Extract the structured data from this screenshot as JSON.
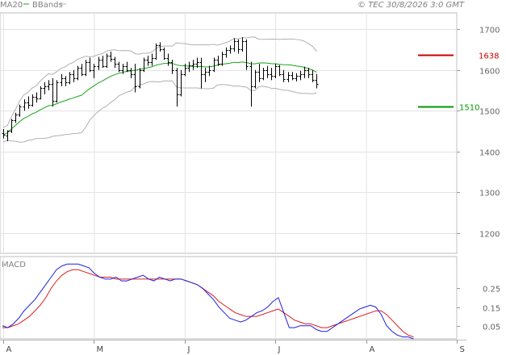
{
  "header": {
    "ma_label": "MA20",
    "bbands_label": "BBands",
    "copyright": "© TEC 30/8/2026 3:0 GMT"
  },
  "colors": {
    "ma": "#17a317",
    "bands": "#b0b0b0",
    "bars": "#000000",
    "macd_line": "#1f1fdd",
    "macd_signal": "#dd1f1f",
    "resistance": "#cc0000",
    "support": "#009900",
    "grid": "#e3e3e3"
  },
  "chart_data": [
    {
      "type": "ohlc",
      "title": "",
      "ylim": [
        1150,
        1740
      ],
      "yticks": [
        1700,
        1600,
        1500,
        1400,
        1300,
        1200
      ],
      "x_labels": [
        "A",
        "M",
        "J",
        "J",
        "A",
        "S"
      ],
      "month_tick_days": [
        0,
        22,
        44,
        66,
        88,
        110
      ],
      "n_days": 110,
      "resistance": {
        "value": 1638,
        "label": "1638"
      },
      "support": {
        "value": 1510,
        "label": "1510"
      },
      "ohlc": [
        [
          1445,
          1455,
          1432,
          1441
        ],
        [
          1440,
          1452,
          1425,
          1450
        ],
        [
          1450,
          1480,
          1445,
          1476
        ],
        [
          1476,
          1495,
          1470,
          1490
        ],
        [
          1490,
          1515,
          1485,
          1510
        ],
        [
          1510,
          1528,
          1500,
          1520
        ],
        [
          1520,
          1535,
          1505,
          1515
        ],
        [
          1515,
          1540,
          1510,
          1535
        ],
        [
          1535,
          1545,
          1520,
          1530
        ],
        [
          1530,
          1560,
          1528,
          1555
        ],
        [
          1555,
          1570,
          1540,
          1560
        ],
        [
          1560,
          1575,
          1550,
          1565
        ],
        [
          1565,
          1580,
          1510,
          1525
        ],
        [
          1525,
          1575,
          1520,
          1570
        ],
        [
          1570,
          1590,
          1560,
          1580
        ],
        [
          1580,
          1585,
          1560,
          1570
        ],
        [
          1570,
          1595,
          1565,
          1590
        ],
        [
          1590,
          1600,
          1570,
          1580
        ],
        [
          1580,
          1610,
          1575,
          1605
        ],
        [
          1605,
          1615,
          1585,
          1590
        ],
        [
          1590,
          1625,
          1585,
          1620
        ],
        [
          1620,
          1630,
          1595,
          1600
        ],
        [
          1600,
          1615,
          1580,
          1610
        ],
        [
          1610,
          1632,
          1600,
          1625
        ],
        [
          1625,
          1635,
          1605,
          1610
        ],
        [
          1610,
          1640,
          1605,
          1635
        ],
        [
          1635,
          1645,
          1620,
          1628
        ],
        [
          1628,
          1632,
          1605,
          1615
        ],
        [
          1615,
          1620,
          1595,
          1600
        ],
        [
          1600,
          1615,
          1590,
          1610
        ],
        [
          1610,
          1620,
          1595,
          1600
        ],
        [
          1600,
          1605,
          1580,
          1590
        ],
        [
          1590,
          1615,
          1545,
          1560
        ],
        [
          1560,
          1605,
          1555,
          1600
        ],
        [
          1600,
          1630,
          1595,
          1625
        ],
        [
          1625,
          1635,
          1610,
          1620
        ],
        [
          1620,
          1640,
          1610,
          1630
        ],
        [
          1630,
          1665,
          1625,
          1660
        ],
        [
          1660,
          1668,
          1645,
          1650
        ],
        [
          1650,
          1655,
          1625,
          1630
        ],
        [
          1630,
          1640,
          1610,
          1620
        ],
        [
          1620,
          1625,
          1590,
          1600
        ],
        [
          1600,
          1605,
          1510,
          1540
        ],
        [
          1540,
          1600,
          1535,
          1590
        ],
        [
          1590,
          1615,
          1585,
          1605
        ],
        [
          1605,
          1620,
          1595,
          1612
        ],
        [
          1612,
          1625,
          1600,
          1615
        ],
        [
          1615,
          1630,
          1605,
          1620
        ],
        [
          1620,
          1630,
          1555,
          1590
        ],
        [
          1590,
          1605,
          1570,
          1595
        ],
        [
          1595,
          1610,
          1585,
          1600
        ],
        [
          1600,
          1630,
          1595,
          1625
        ],
        [
          1625,
          1635,
          1610,
          1615
        ],
        [
          1615,
          1645,
          1610,
          1640
        ],
        [
          1640,
          1655,
          1630,
          1648
        ],
        [
          1648,
          1660,
          1640,
          1652
        ],
        [
          1652,
          1678,
          1645,
          1670
        ],
        [
          1670,
          1675,
          1640,
          1650
        ],
        [
          1650,
          1680,
          1645,
          1670
        ],
        [
          1670,
          1675,
          1600,
          1610
        ],
        [
          1610,
          1620,
          1510,
          1560
        ],
        [
          1560,
          1600,
          1555,
          1595
        ],
        [
          1595,
          1615,
          1570,
          1580
        ],
        [
          1580,
          1605,
          1575,
          1600
        ],
        [
          1600,
          1610,
          1580,
          1590
        ],
        [
          1590,
          1605,
          1575,
          1585
        ],
        [
          1585,
          1615,
          1580,
          1610
        ],
        [
          1610,
          1612,
          1585,
          1590
        ],
        [
          1590,
          1600,
          1570,
          1578
        ],
        [
          1578,
          1595,
          1570,
          1588
        ],
        [
          1588,
          1595,
          1575,
          1580
        ],
        [
          1580,
          1592,
          1572,
          1585
        ],
        [
          1585,
          1598,
          1575,
          1590
        ],
        [
          1590,
          1608,
          1580,
          1600
        ],
        [
          1600,
          1605,
          1580,
          1590
        ],
        [
          1590,
          1600,
          1570,
          1575
        ],
        [
          1575,
          1590,
          1555,
          1565
        ]
      ]
    },
    {
      "type": "line",
      "title": "MACD",
      "ylim": [
        -0.02,
        0.42
      ],
      "yticks": [
        0.25,
        0.15,
        0.05
      ],
      "ytick_labels": [
        "0.25",
        "0.15",
        "0.05"
      ],
      "macd": [
        0.05,
        0.04,
        0.06,
        0.09,
        0.13,
        0.16,
        0.19,
        0.23,
        0.27,
        0.31,
        0.35,
        0.37,
        0.38,
        0.38,
        0.38,
        0.37,
        0.36,
        0.33,
        0.31,
        0.3,
        0.3,
        0.31,
        0.29,
        0.29,
        0.3,
        0.31,
        0.32,
        0.3,
        0.29,
        0.31,
        0.3,
        0.29,
        0.3,
        0.3,
        0.29,
        0.28,
        0.27,
        0.25,
        0.22,
        0.19,
        0.15,
        0.12,
        0.09,
        0.08,
        0.07,
        0.08,
        0.1,
        0.12,
        0.13,
        0.15,
        0.18,
        0.2,
        0.12,
        0.04,
        0.04,
        0.05,
        0.05,
        0.05,
        0.03,
        0.02,
        0.02,
        0.04,
        0.06,
        0.08,
        0.1,
        0.12,
        0.14,
        0.15,
        0.16,
        0.15,
        0.11,
        0.05,
        0.02,
        0.0,
        -0.01,
        -0.01,
        -0.02
      ],
      "signal": [
        0.04,
        0.04,
        0.05,
        0.06,
        0.08,
        0.1,
        0.13,
        0.16,
        0.2,
        0.25,
        0.29,
        0.32,
        0.34,
        0.35,
        0.35,
        0.34,
        0.33,
        0.32,
        0.31,
        0.31,
        0.31,
        0.3,
        0.3,
        0.3,
        0.3,
        0.3,
        0.3,
        0.3,
        0.3,
        0.3,
        0.3,
        0.3,
        0.3,
        0.3,
        0.29,
        0.28,
        0.27,
        0.25,
        0.23,
        0.21,
        0.18,
        0.16,
        0.14,
        0.12,
        0.11,
        0.1,
        0.1,
        0.1,
        0.11,
        0.12,
        0.13,
        0.14,
        0.12,
        0.1,
        0.08,
        0.07,
        0.06,
        0.06,
        0.05,
        0.04,
        0.04,
        0.05,
        0.06,
        0.07,
        0.08,
        0.09,
        0.1,
        0.11,
        0.12,
        0.13,
        0.13,
        0.11,
        0.08,
        0.05,
        0.02,
        0.0,
        -0.01
      ]
    }
  ]
}
